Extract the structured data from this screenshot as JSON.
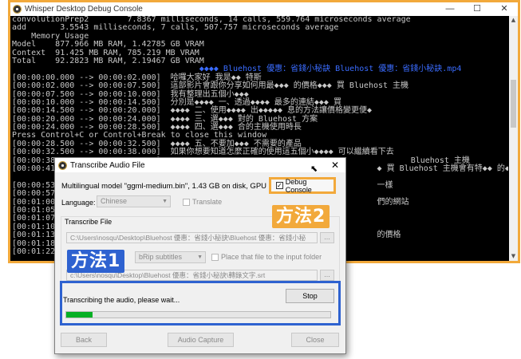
{
  "console": {
    "title": "Whisper Desktop Debug Console",
    "window_controls": [
      "—",
      "☐",
      "✕"
    ],
    "lines": [
      {
        "text": "convolutionPrep2        7.8367 milliseconds, 14 calls, 559.764 microseconds average",
        "color": "gray"
      },
      {
        "text": "add       3.5543 milliseconds, 7 calls, 507.757 microseconds average",
        "color": "gray"
      },
      {
        "text": "    Memory Usage",
        "color": "gray"
      },
      {
        "text": "Model    877.966 MB RAM, 1.42785 GB VRAM",
        "color": "gray"
      },
      {
        "text": "Context  91.425 MB RAM, 785.219 MB VRAM",
        "color": "gray"
      },
      {
        "text": "Total    92.2823 MB RAM, 2.19467 GB VRAM",
        "color": "gray"
      },
      {
        "text": "                                       ◆◆◆◆ Bluehost 優惠：省錢小秘訣 Bluehost 優惠：省錢小秘訣.mp4",
        "color": "blue"
      },
      {
        "text": "[00:00:00.000 --> 00:00:02.000]  哈囉大家好 我是◆◆ 特斯",
        "color": "gray"
      },
      {
        "text": "[00:00:02.000 --> 00:00:07.500]  這部影片會跟你分享如何用最◆◆◆ 的價格◆◆◆ 買 Bluehost 主機",
        "color": "gray"
      },
      {
        "text": "[00:00:07.500 --> 00:00:10.000]  我有整理出五個小◆◆◆",
        "color": "gray"
      },
      {
        "text": "[00:00:10.000 --> 00:00:14.500]  分別是◆◆◆◆ 一、透過◆◆◆◆ 最多的連結◆◆◆ 買",
        "color": "gray"
      },
      {
        "text": "[00:00:14.500 --> 00:00:20.000]  ◆◆◆◆ 二、使用◆◆◆◆ 出◆◆◆◆◆ 息的方法讓價格變更便◆",
        "color": "gray"
      },
      {
        "text": "[00:00:20.000 --> 00:00:24.000]  ◆◆◆◆ 三、選◆◆◆ 對的 Bluehost 方案",
        "color": "gray"
      },
      {
        "text": "[00:00:24.000 --> 00:00:28.500]  ◆◆◆◆ 四、選◆◆◆ 合的主機使用時長",
        "color": "gray"
      },
      {
        "text": "Press Control+C or Control+Break to close this window",
        "color": "gray"
      },
      {
        "text": "[00:00:28.500 --> 00:00:32.500]  ◆◆◆◆ 五、不要加◆◆◆ 不需要的產品",
        "color": "gray"
      },
      {
        "text": "[00:00:32.500 --> 00:00:38.000]  如果你想要知道怎麼正確的使用這五個小◆◆◆◆ 可以繼續看下去",
        "color": "gray"
      },
      {
        "text": "[00:00:38.000 --> 00:00:41.000]                                                    Bluehost 主機",
        "color": "gray"
      },
      {
        "text": "[00:00:41.000 --> 00:00:45.000]                                             ◆ 買 Bluehost 主機會有特◆◆ 的◆",
        "color": "gray"
      },
      {
        "text": "",
        "color": "gray"
      },
      {
        "text": "[00:00:53.000                                                               一樣",
        "color": "gray"
      },
      {
        "text": "[00:00:57.000",
        "color": "gray"
      },
      {
        "text": "[00:01:00.000                                                               們的網站",
        "color": "gray"
      },
      {
        "text": "[00:01:05.500",
        "color": "gray"
      },
      {
        "text": "[00:01:07.000",
        "color": "gray"
      },
      {
        "text": "[00:01:10.000",
        "color": "gray"
      },
      {
        "text": "[00:01:13.500                                                               的價格",
        "color": "gray"
      },
      {
        "text": "[00:01:18.000",
        "color": "gray"
      },
      {
        "text": "[00:01:22.500",
        "color": "gray"
      }
    ]
  },
  "dialog": {
    "title": "Transcribe Audio File",
    "close_glyph": "✕",
    "model_info": "Multilingual model \"ggml-medium.bin\", 1.43 GB on disk, GPU",
    "debug_console_label": "Debug Console",
    "debug_console_checked": true,
    "language_label": "Language:",
    "language_value": "Chinese",
    "translate_label": "Translate",
    "transcribe_file_label": "Transcribe File",
    "input_path": "C:\\Users\\nosqu\\Desktop\\Bluehost 優惠：省錢小秘訣\\Bluehost 優惠：省錢小秘",
    "browse_label": "...",
    "output_format": "SubRip subtitles",
    "output_format_visible": "bRip subtitles",
    "place_file_label": "Place that file to the input folder",
    "output_path": "C:\\Users\\nosqu\\Desktop\\Bluehost 優惠：省錢小秘訣\\轉錄文字.srt",
    "output_path_visible": "c:\\Users\\nosqu\\Desktop\\Bluehost 優惠：省錢小秘訣\\轉錄文字.srt",
    "status": "Transcribing the audio, please wait...",
    "stop_label": "Stop",
    "progress_fraction": 0.1,
    "back_label": "Back",
    "audio_capture_label": "Audio Capture",
    "close_label": "Close"
  },
  "annotations": {
    "method1": "方法1",
    "method2": "方法2",
    "method1_color": "#2e62d0",
    "method2_color": "#f2a93b"
  }
}
